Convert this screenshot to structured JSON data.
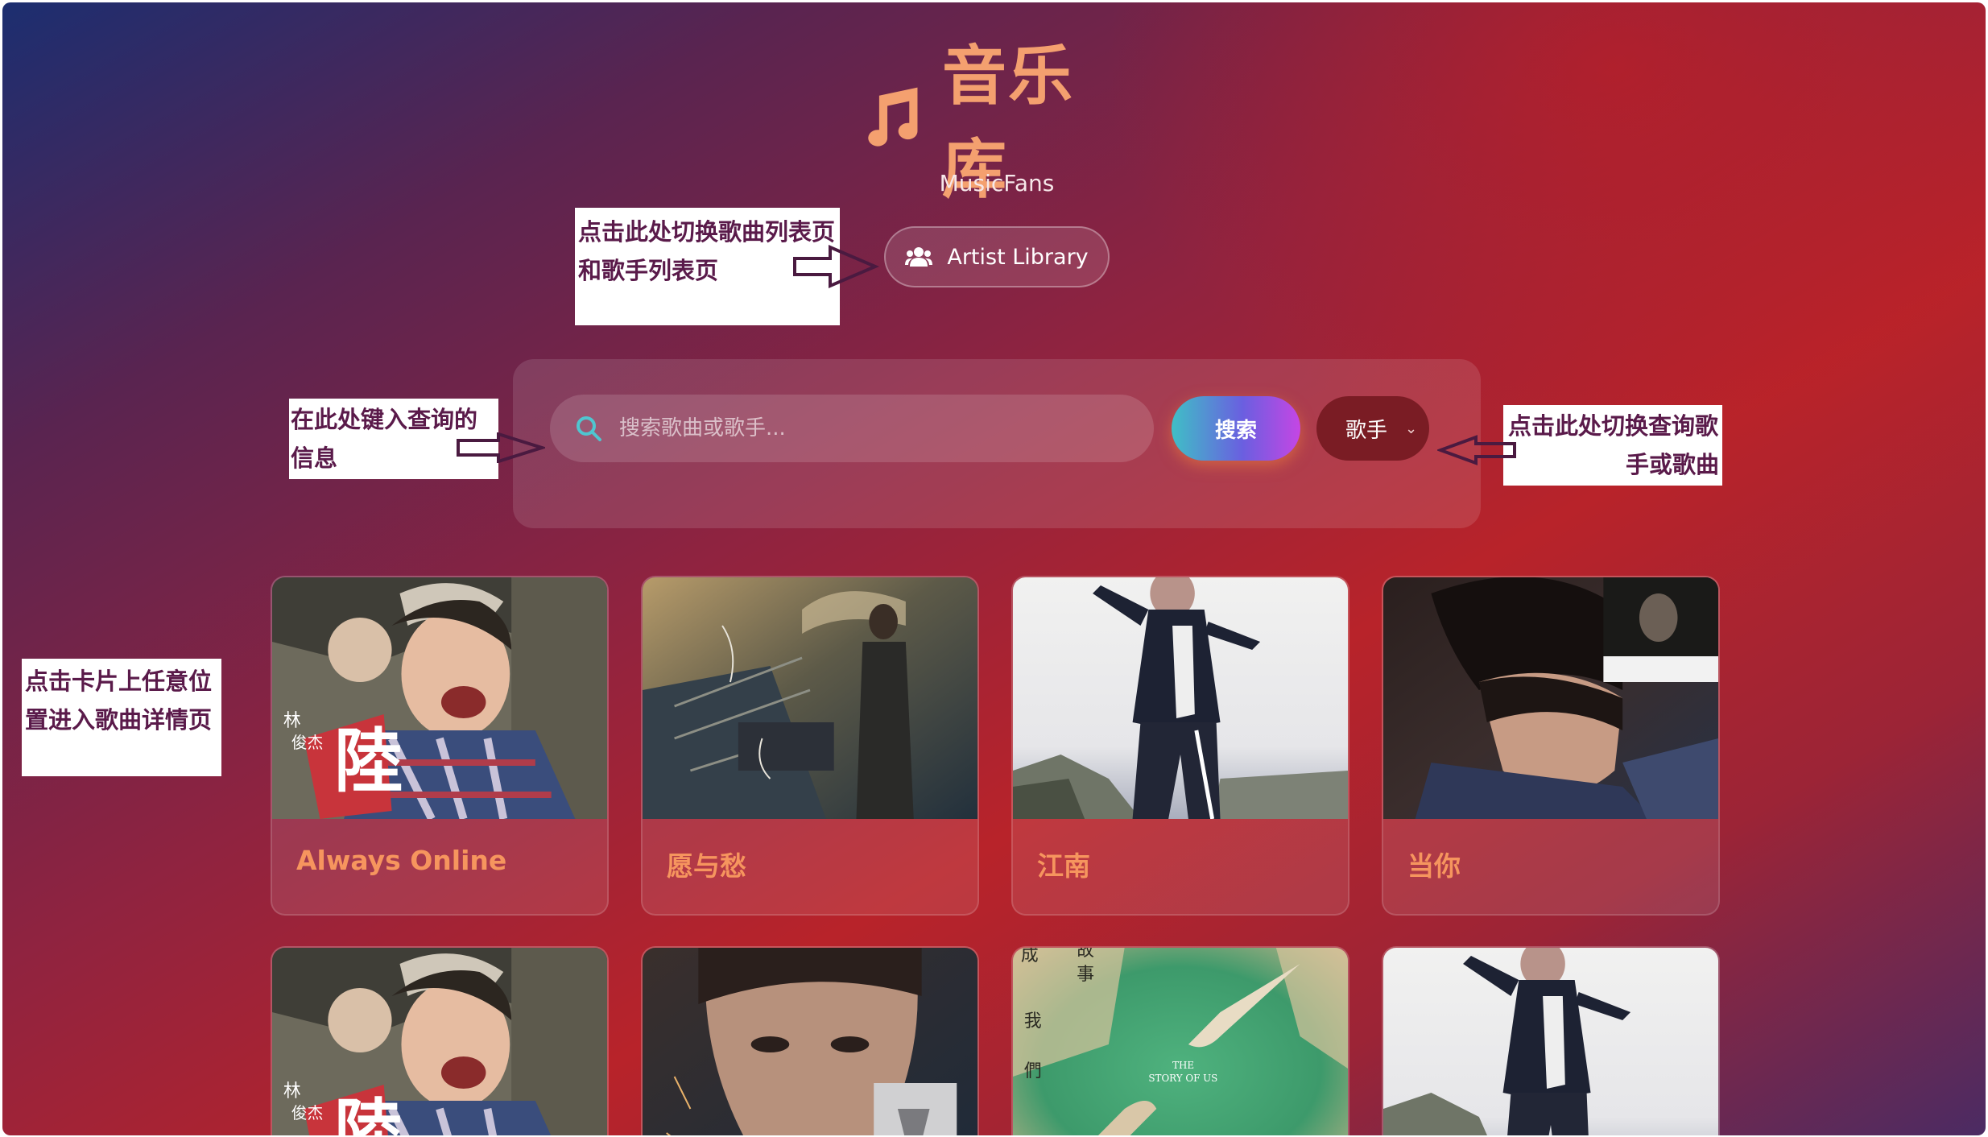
{
  "header": {
    "title": "音乐库",
    "subtitle": "MusicFans",
    "artist_library_label": "Artist Library"
  },
  "search": {
    "placeholder": "搜索歌曲或歌手...",
    "button_label": "搜索",
    "type_selected": "歌手"
  },
  "annotations": {
    "switch_page": [
      "点击此处切换歌曲列表页",
      "和歌手列表页"
    ],
    "type_query": [
      "在此处键入查询的",
      "信息"
    ],
    "switch_type": [
      "点击此处切换查询歌",
      "手或歌曲"
    ],
    "card_click": [
      "点击卡片上任意位",
      "置进入歌曲详情页"
    ]
  },
  "songs": [
    {
      "title": "Always Online"
    },
    {
      "title": "愿与愁"
    },
    {
      "title": "江南"
    },
    {
      "title": "当你"
    },
    {
      "title": ""
    },
    {
      "title": ""
    },
    {
      "title": ""
    },
    {
      "title": ""
    }
  ],
  "cover_text": {
    "sixology_chars": [
      "林",
      "俊杰"
    ],
    "sixology_big": "陸",
    "story_of_us": [
      "THE",
      "STORY OF US"
    ],
    "story_chars": [
      "成",
      "故",
      "事",
      "我",
      "們"
    ]
  },
  "colors": {
    "title": "#f4a06f",
    "song_title": "#f6955e",
    "annotation_text": "#5a1a4a",
    "select_bg": "#7a1c24"
  },
  "icons": [
    "music-note-icon",
    "users-icon",
    "search-icon",
    "chevron-down-icon",
    "arrow-right-icon",
    "arrow-left-icon"
  ]
}
